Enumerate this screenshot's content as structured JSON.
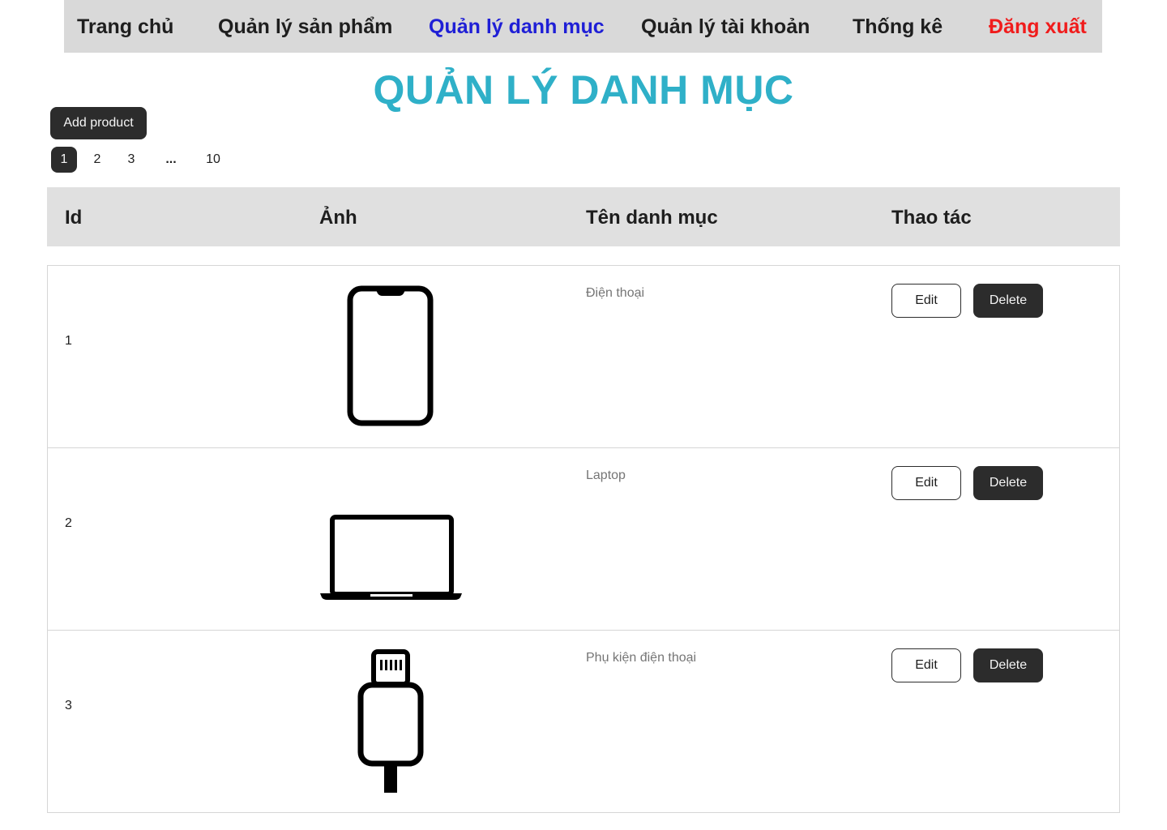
{
  "nav": {
    "items": [
      {
        "label": "Trang chủ"
      },
      {
        "label": "Quản lý sản phẩm"
      },
      {
        "label": "Quản lý danh mục"
      },
      {
        "label": "Quản lý tài khoản"
      },
      {
        "label": "Thống kê"
      },
      {
        "label": "Đăng xuất"
      }
    ],
    "active_index": 2,
    "colors": {
      "active": "#1f1fd6",
      "logout": "#f01c1c"
    }
  },
  "page": {
    "title": "QUẢN LÝ DANH MỤC",
    "title_color": "#2fb0c8",
    "add_button_label": "Add product"
  },
  "pagination": {
    "pages": [
      "1",
      "2",
      "3",
      "...",
      "10"
    ],
    "current": "1"
  },
  "table": {
    "headers": {
      "id": "Id",
      "image": "Ảnh",
      "name": "Tên danh mục",
      "actions": "Thao tác"
    },
    "edit_label": "Edit",
    "delete_label": "Delete",
    "rows": [
      {
        "id": "1",
        "name": "Điện thoại",
        "icon": "smartphone-icon"
      },
      {
        "id": "2",
        "name": "Laptop",
        "icon": "laptop-icon"
      },
      {
        "id": "3",
        "name": "Phụ kiện điện thoại",
        "icon": "usb-cable-icon"
      }
    ]
  }
}
